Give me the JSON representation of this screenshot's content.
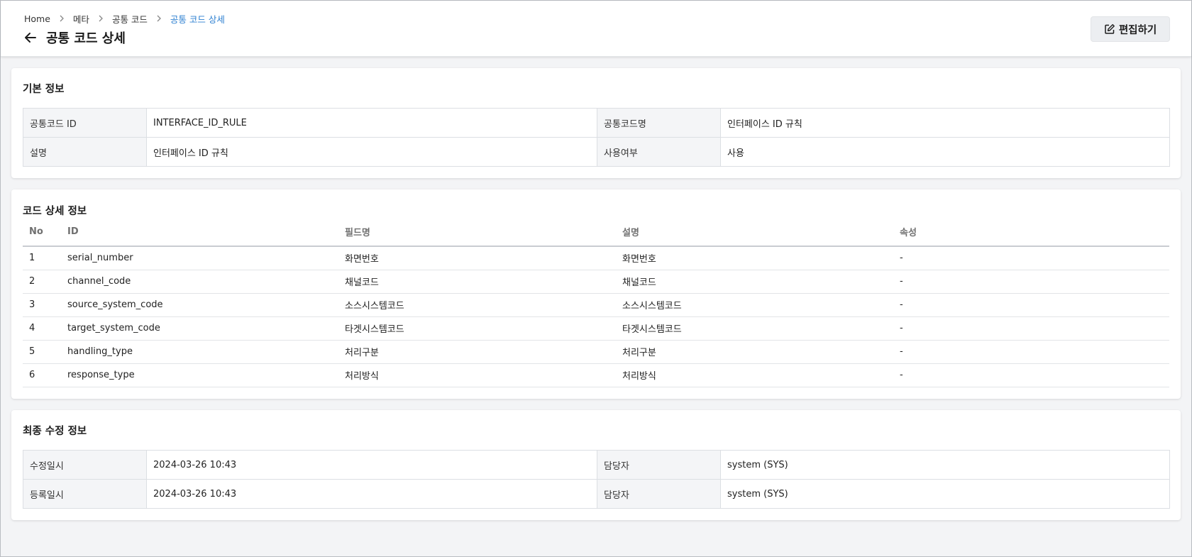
{
  "breadcrumb": [
    "Home",
    "메타",
    "공통 코드",
    "공통 코드 상세"
  ],
  "page_title": "공통 코드 상세",
  "edit_label": "편집하기",
  "basic_info": {
    "title": "기본 정보",
    "rows": [
      [
        {
          "label": "공통코드 ID",
          "value": "INTERFACE_ID_RULE"
        },
        {
          "label": "공통코드명",
          "value": "인터페이스 ID 규칙"
        }
      ],
      [
        {
          "label": "설명",
          "value": "인터페이스 ID 규칙"
        },
        {
          "label": "사용여부",
          "value": "사용"
        }
      ]
    ]
  },
  "code_detail": {
    "title": "코드 상세 정보",
    "columns": [
      "No",
      "ID",
      "필드명",
      "설명",
      "속성"
    ],
    "rows": [
      [
        "1",
        "serial_number",
        "화면번호",
        "화면번호",
        "-"
      ],
      [
        "2",
        "channel_code",
        "채널코드",
        "채널코드",
        "-"
      ],
      [
        "3",
        "source_system_code",
        "소스시스템코드",
        "소스시스템코드",
        "-"
      ],
      [
        "4",
        "target_system_code",
        "타겟시스템코드",
        "타겟시스템코드",
        "-"
      ],
      [
        "5",
        "handling_type",
        "처리구분",
        "처리구분",
        "-"
      ],
      [
        "6",
        "response_type",
        "처리방식",
        "처리방식",
        "-"
      ]
    ]
  },
  "last_modified": {
    "title": "최종 수정 정보",
    "rows": [
      [
        {
          "label": "수정일시",
          "value": "2024-03-26 10:43"
        },
        {
          "label": "담당자",
          "value": "system (SYS)"
        }
      ],
      [
        {
          "label": "등록일시",
          "value": "2024-03-26 10:43"
        },
        {
          "label": "담당자",
          "value": "system (SYS)"
        }
      ]
    ]
  },
  "colors": {
    "accent": "#2c7fd1",
    "label_bg": "#f4f5f7",
    "page_bg": "#f3f4f6"
  }
}
